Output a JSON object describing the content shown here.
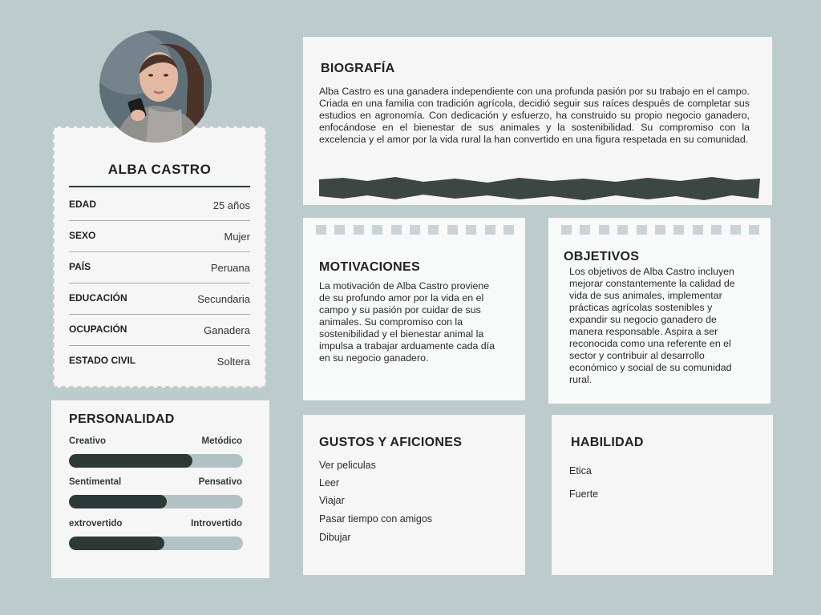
{
  "profile": {
    "name": "ALBA CASTRO",
    "rows": [
      {
        "label": "EDAD",
        "value": "25 años"
      },
      {
        "label": "SEXO",
        "value": "Mujer"
      },
      {
        "label": "PAÍS",
        "value": "Peruana"
      },
      {
        "label": "EDUCACIÓN",
        "value": "Secundaria"
      },
      {
        "label": "OCUPACIÓN",
        "value": "Ganadera"
      },
      {
        "label": "ESTADO CIVIL",
        "value": "Soltera"
      }
    ]
  },
  "personality": {
    "title": "PERSONALIDAD",
    "traits": [
      {
        "left": "Creativo",
        "right": "Metódico",
        "level": 0.71
      },
      {
        "left": "Sentimental",
        "right": "Pensativo",
        "level": 0.56
      },
      {
        "left": "extrovertido",
        "right": "Introvertido",
        "level": 0.55
      }
    ]
  },
  "biography": {
    "title": "BIOGRAFÍA",
    "text": "Alba Castro es una ganadera independiente con una profunda pasión por su trabajo en el campo. Criada en una familia con tradición agrícola, decidió seguir sus raíces después de completar sus estudios en agronomía. Con dedicación y esfuerzo, ha construido su propio negocio ganadero, enfocándose en el bienestar de sus animales y la sostenibilidad. Su compromiso con la excelencia y el amor por la vida rural la han convertido en una figura respetada en su comunidad."
  },
  "motivaciones": {
    "title": "MOTIVACIONES",
    "text": "La motivación de Alba Castro proviene de su profundo amor por la vida en el campo y su pasión por cuidar de sus animales. Su compromiso con la sostenibilidad y el bienestar animal la impulsa a trabajar arduamente cada día en su negocio ganadero."
  },
  "objetivos": {
    "title": "OBJETIVOS",
    "text": "Los objetivos de Alba Castro incluyen mejorar constantemente la calidad de vida de sus animales, implementar prácticas agrícolas sostenibles y expandir su negocio ganadero de manera responsable. Aspira a ser reconocida como una referente en el sector y contribuir al desarrollo económico y social de su comunidad rural."
  },
  "gustos": {
    "title": "GUSTOS Y AFICIONES",
    "items": [
      "Ver peliculas",
      "Leer",
      "Viajar",
      "Pasar tiempo con amigos",
      "Dibujar"
    ]
  },
  "habilidad": {
    "title": "HABILIDAD",
    "items": [
      "Etica",
      "Fuerte"
    ]
  },
  "colors": {
    "background": "#bccbcc",
    "paper": "#f6f6f6",
    "bar_fill": "#2d3936",
    "bar_track": "#b3c2c5",
    "torn_strip": "#3c4643"
  }
}
